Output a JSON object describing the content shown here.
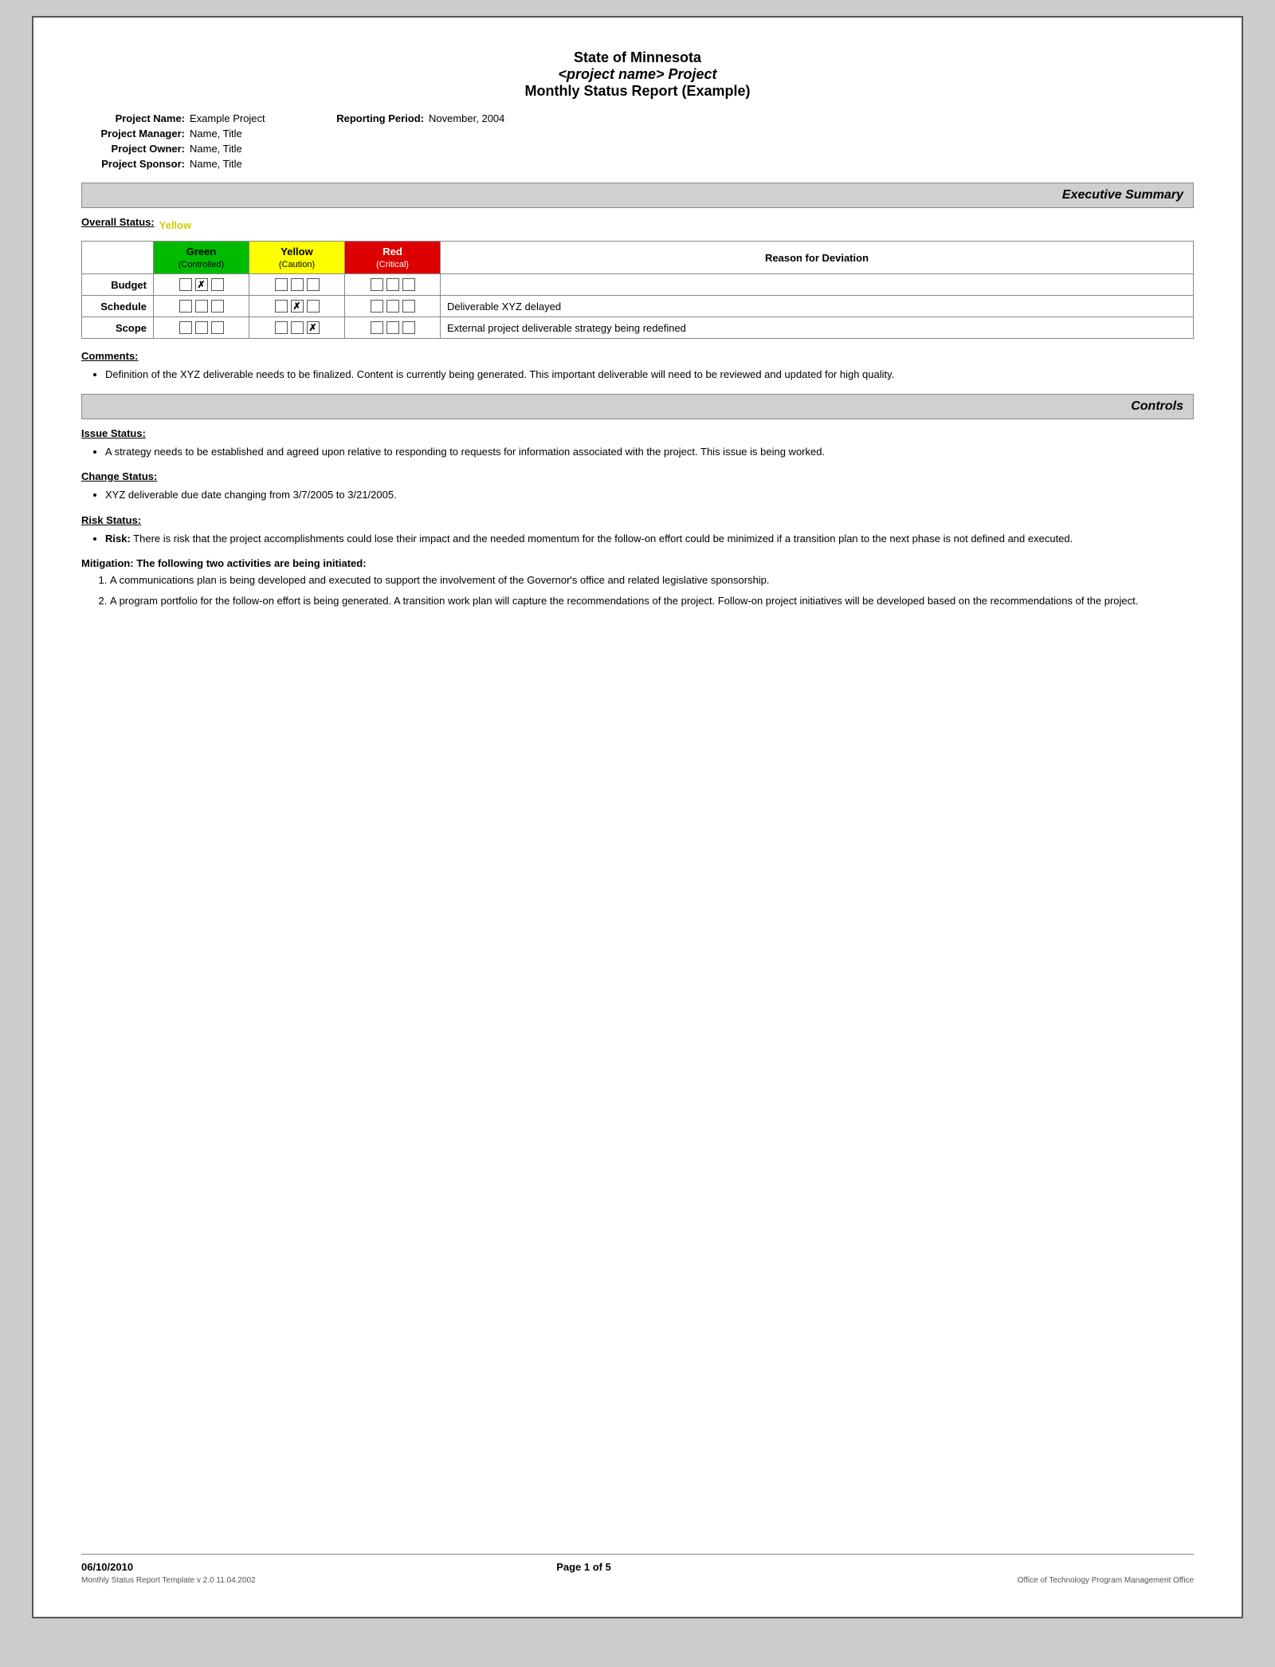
{
  "doc": {
    "title_line1": "State of Minnesota",
    "title_line2": "<project name> Project",
    "title_line3": "Monthly Status Report (Example)"
  },
  "meta": {
    "project_name_label": "Project Name:",
    "project_name_value": "Example Project",
    "reporting_period_label": "Reporting Period:",
    "reporting_period_value": "November, 2004",
    "project_manager_label": "Project Manager:",
    "project_manager_value": "Name, Title",
    "project_owner_label": "Project Owner:",
    "project_owner_value": "Name, Title",
    "project_sponsor_label": "Project Sponsor:",
    "project_sponsor_value": "Name, Title"
  },
  "sections": {
    "executive_summary": "Executive Summary",
    "controls": "Controls"
  },
  "overall_status": {
    "label": "Overall Status:",
    "value": "Yellow"
  },
  "status_table": {
    "headers": {
      "green_label": "Green",
      "green_sub": "(Controlled)",
      "yellow_label": "Yellow",
      "yellow_sub": "(Caution)",
      "red_label": "Red",
      "red_sub": "(Critical)",
      "reason_label": "Reason for Deviation"
    },
    "rows": [
      {
        "label": "Budget",
        "green": [
          false,
          true,
          false
        ],
        "yellow": [
          false,
          false,
          false
        ],
        "red": [
          false,
          false,
          false
        ],
        "reason": ""
      },
      {
        "label": "Schedule",
        "green": [
          false,
          false,
          false
        ],
        "yellow": [
          false,
          true,
          false
        ],
        "red": [
          false,
          false,
          false
        ],
        "reason": "Deliverable XYZ delayed"
      },
      {
        "label": "Scope",
        "green": [
          false,
          false,
          false
        ],
        "yellow": [
          false,
          false,
          true
        ],
        "red": [
          false,
          false,
          false
        ],
        "reason": "External project deliverable strategy being redefined"
      }
    ]
  },
  "comments": {
    "label": "Comments:",
    "bullets": [
      "Definition of the XYZ deliverable needs to be finalized.  Content is currently being generated.  This important deliverable will need to be reviewed and updated for high quality."
    ]
  },
  "issue_status": {
    "label": "Issue Status:",
    "bullets": [
      "A strategy needs to be established and agreed upon relative to responding to requests for information associated with the project.  This issue is being worked."
    ]
  },
  "change_status": {
    "label": "Change Status:",
    "bullets": [
      "XYZ deliverable due date changing from 3/7/2005 to 3/21/2005."
    ]
  },
  "risk_status": {
    "label": "Risk Status:",
    "risk_bold": "Risk:",
    "risk_text": " There is risk that the project accomplishments could lose their impact and the needed momentum for the follow-on effort could be minimized if a transition plan to the next phase is not defined and executed.",
    "mitigation_label": "Mitigation:",
    "mitigation_intro": " The following two activities are being initiated:",
    "mitigation_items": [
      "A communications plan is being developed and executed to support the involvement of the Governor's office and related legislative sponsorship.",
      "A program portfolio for the follow-on effort is being generated. A transition work plan will capture the recommendations of the project. Follow-on project initiatives will be developed based on the recommendations of the project."
    ]
  },
  "footer": {
    "date": "06/10/2010",
    "page": "Page 1 of 5",
    "template": "Monthly Status Report Template  v 2.0  11.04.2002",
    "office": "Office of Technology Program Management Office"
  }
}
